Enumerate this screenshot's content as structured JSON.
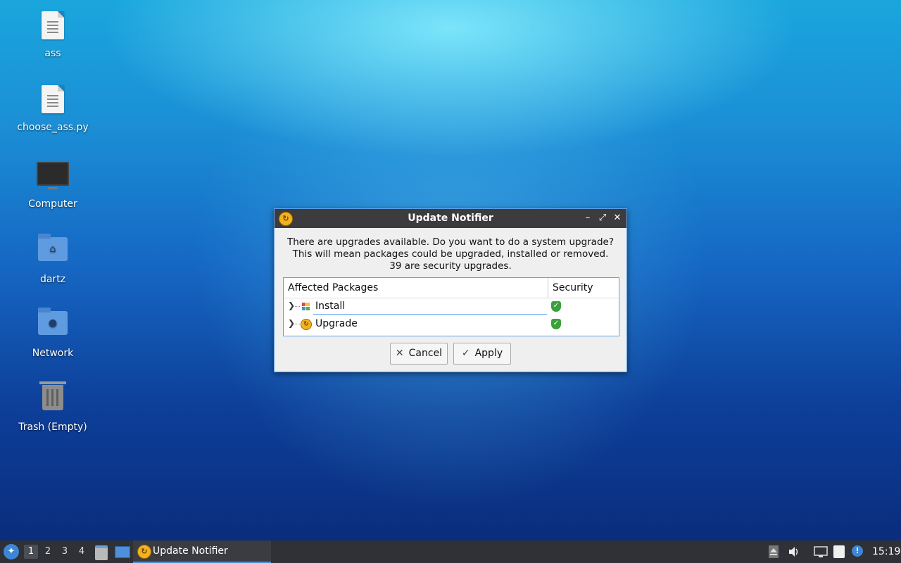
{
  "desktop": {
    "icons": [
      {
        "label": "ass",
        "icon": "text-file-icon"
      },
      {
        "label": "choose_ass.py",
        "icon": "text-file-icon"
      },
      {
        "label": "Computer",
        "icon": "computer-icon"
      },
      {
        "label": "dartz",
        "icon": "home-folder-icon"
      },
      {
        "label": "Network",
        "icon": "network-folder-icon"
      },
      {
        "label": "Trash (Empty)",
        "icon": "trash-icon"
      }
    ]
  },
  "dialog": {
    "title": "Update Notifier",
    "message_lines": [
      "There are upgrades available. Do you want to do a system upgrade?",
      "This will mean packages could be upgraded, installed or removed.",
      "39 are security upgrades."
    ],
    "table": {
      "columns": [
        "Affected Packages",
        "Security"
      ],
      "rows": [
        {
          "label": "Install",
          "icon": "install-package-icon",
          "security": "shield-check-icon"
        },
        {
          "label": "Upgrade",
          "icon": "update-notifier-icon",
          "security": "shield-check-icon"
        }
      ]
    },
    "buttons": {
      "cancel": "Cancel",
      "apply": "Apply"
    }
  },
  "taskbar": {
    "workspaces": [
      "1",
      "2",
      "3",
      "4"
    ],
    "active_workspace": "1",
    "task_label": "Update Notifier",
    "clock": "15:19"
  },
  "colors": {
    "accent": "#5ea1e6",
    "titlebar": "#3c3c3f",
    "taskbar": "#2f3136",
    "shield": "#3aa13a"
  }
}
